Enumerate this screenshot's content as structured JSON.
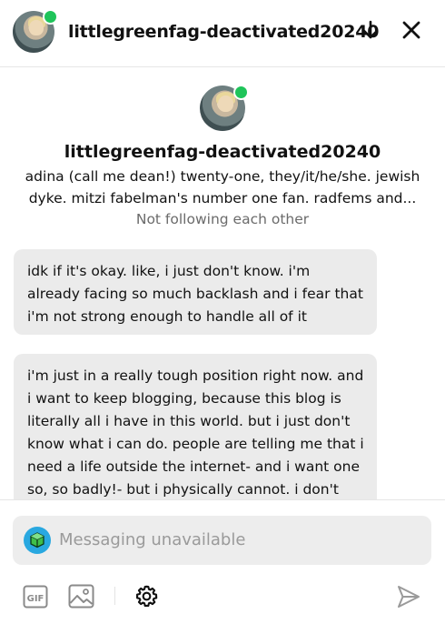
{
  "header": {
    "username": "littlegreenfag-deactivated20240",
    "scroll_down_icon": "arrow-down-icon",
    "close_icon": "close-icon"
  },
  "profile": {
    "username": "littlegreenfag-deactivated20240",
    "bio": "adina (call me dean!) twenty-one, they/it/he/she. jewish dyke. mitzi fabelman's number one fan. radfems and...",
    "follow_status": "Not following each other"
  },
  "messages": [
    {
      "text": "idk if it's okay. like, i just don't know. i'm already facing so much backlash and i fear that i'm not strong enough to handle all of it"
    },
    {
      "text": "i'm just in a really tough position right now. and i want to keep blogging, because this blog is literally all i have in this world. but i just don't know what i can do. people are telling me that i need a life outside the internet- and i want one so, so badly!- but i physically cannot. i don't"
    }
  ],
  "composer": {
    "placeholder": "Messaging unavailable",
    "toolbar": [
      "gif-icon",
      "image-icon",
      "gear-icon",
      "send-icon"
    ]
  },
  "colors": {
    "online": "#1fc45a",
    "bubble": "#ebebeb",
    "composer_bg": "#ededed",
    "muted_text": "#6b6b6b",
    "placeholder": "#9a9a9a",
    "composer_avatar": "#29a8e0"
  }
}
